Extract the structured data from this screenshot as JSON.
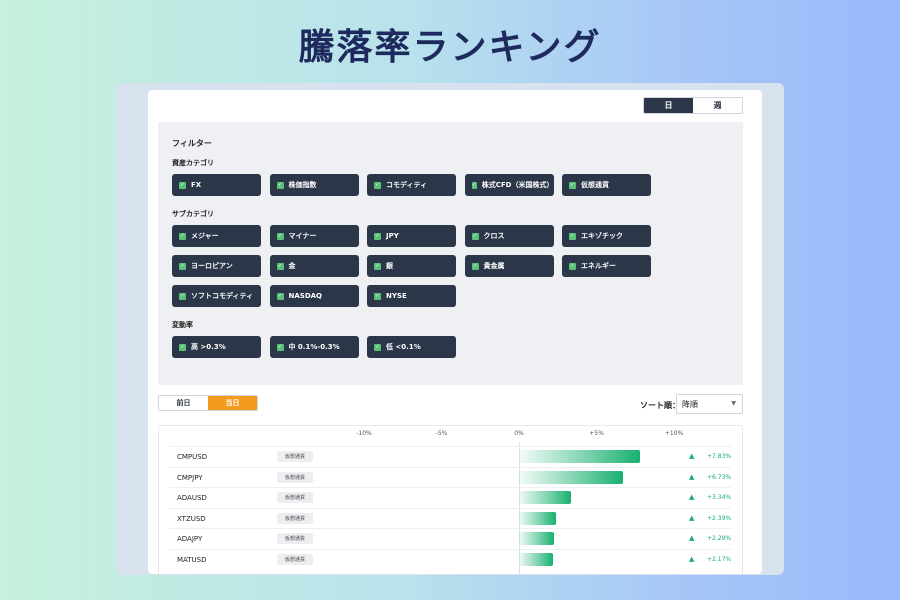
{
  "headline": "騰落率ランキング",
  "period_toggle": {
    "day": "日",
    "week": "週",
    "active": "day"
  },
  "filter": {
    "title": "フィルター",
    "asset_category": {
      "label": "資産カテゴリ",
      "items": [
        "FX",
        "株価指数",
        "コモディティ",
        "株式CFD（米国株式）",
        "仮想通貨"
      ]
    },
    "sub_category": {
      "label": "サブカテゴリ",
      "items": [
        "メジャー",
        "マイナー",
        "JPY",
        "クロス",
        "エキゾチック",
        "ヨーロピアン",
        "金",
        "銀",
        "貴金属",
        "エネルギー",
        "ソフトコモディティ",
        "NASDAQ",
        "NYSE"
      ]
    },
    "volatility": {
      "label": "変動率",
      "items": [
        "高 >0.3%",
        "中 0.1%-0.3%",
        "低 <0.1%"
      ]
    }
  },
  "day_toggle": {
    "previous": "前日",
    "today": "当日",
    "active": "today"
  },
  "sort": {
    "label": "ソート順：",
    "value": "降順"
  },
  "chart_data": {
    "type": "bar",
    "x_ticks": [
      "-10%",
      "-5%",
      "0%",
      "+5%",
      "+10%"
    ],
    "xlim": [
      -10,
      10
    ],
    "categories": [
      "CMPUSD",
      "CMPJPY",
      "ADAUSD",
      "XTZUSD",
      "ADAJPY",
      "MATUSD"
    ],
    "tags": [
      "仮想通貨",
      "仮想通貨",
      "仮想通貨",
      "仮想通貨",
      "仮想通貨",
      "仮想通貨"
    ],
    "values": [
      7.83,
      6.73,
      3.34,
      2.39,
      2.29,
      2.17
    ],
    "value_labels": [
      "+7.83%",
      "+6.73%",
      "+3.34%",
      "+2.39%",
      "+2.29%",
      "+2.17%"
    ],
    "bar_color": "#17b06f"
  }
}
